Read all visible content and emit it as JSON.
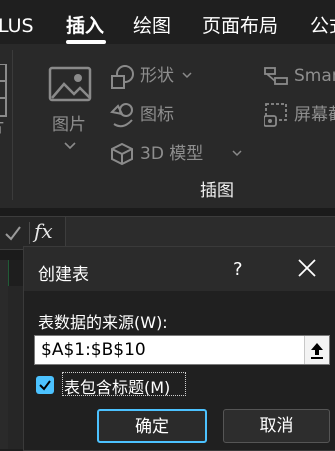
{
  "ribbon_tabs": [
    {
      "label": "LUS"
    },
    {
      "label": "插入",
      "active": true
    },
    {
      "label": "绘图"
    },
    {
      "label": "页面布局"
    },
    {
      "label": "公式"
    }
  ],
  "ribbon": {
    "picture_label": "图片",
    "picture_partial": "片",
    "shapes_label": "形状",
    "icons_label": "图标",
    "model_label": "3D 模型",
    "smartart_label": "Smar",
    "screenshot_label": "屏幕截",
    "group_label": "插图"
  },
  "formula_bar": {
    "fx_label": "fx"
  },
  "dialog": {
    "title": "创建表",
    "help": "?",
    "source_label": "表数据的来源(W):",
    "source_value": "$A$1:$B$10",
    "has_headers_label": "表包含标题(M)",
    "has_headers_checked": true,
    "ok_label": "确定",
    "cancel_label": "取消"
  },
  "colors": {
    "accent": "#4cc2ff",
    "background": "#1e1e1e",
    "dialog_bg": "#202020"
  }
}
